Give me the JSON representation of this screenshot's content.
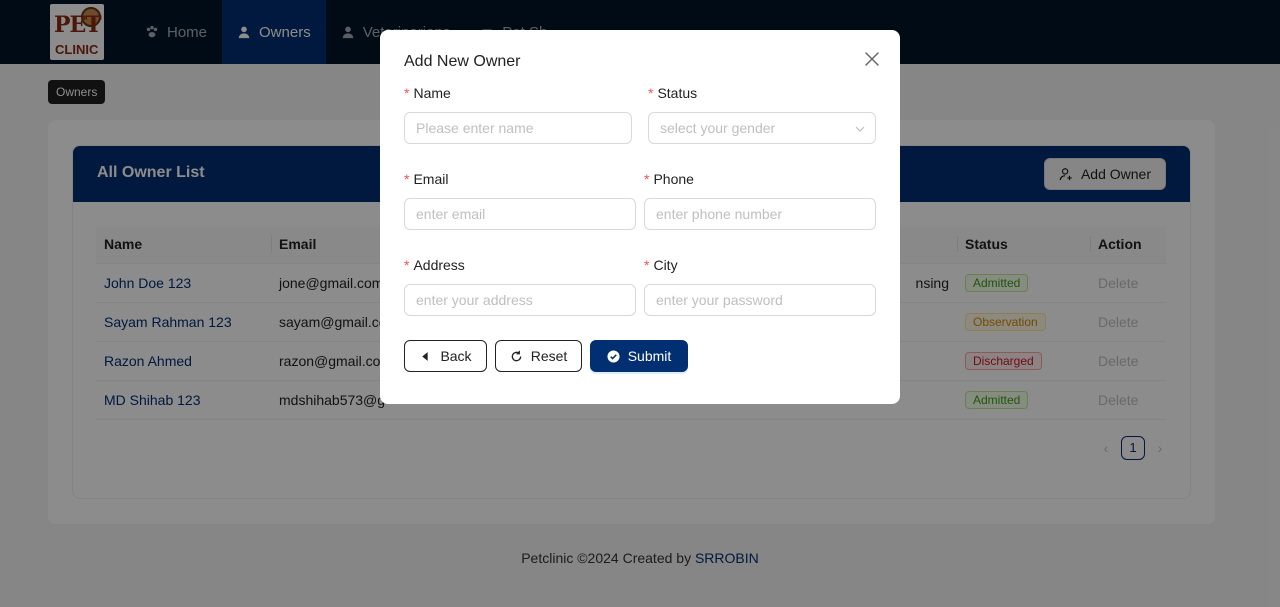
{
  "header": {
    "logo": {
      "line1": "PET",
      "line2": "CLINIC"
    },
    "nav": [
      {
        "label": "Home",
        "icon": "paw-icon",
        "active": false
      },
      {
        "label": "Owners",
        "icon": "user-icon",
        "active": true
      },
      {
        "label": "Veterinarians",
        "icon": "doctor-icon",
        "active": false
      },
      {
        "label": "Pet Sh...",
        "icon": "pet-icon",
        "active": false
      }
    ]
  },
  "breadcrumb": "Owners",
  "card": {
    "title": "All Owner List",
    "add_button": "Add Owner"
  },
  "table": {
    "columns": [
      "Name",
      "Email",
      "Status",
      "Action"
    ],
    "rows": [
      {
        "name": "John Doe 123",
        "email": "jone@gmail.com",
        "extra": "nsing",
        "status": "Admitted",
        "status_color": "green",
        "action": "Delete"
      },
      {
        "name": "Sayam Rahman 123",
        "email": "sayam@gmail.co",
        "extra": "",
        "status": "Observation",
        "status_color": "orange",
        "action": "Delete"
      },
      {
        "name": "Razon Ahmed",
        "email": "razon@gmail.co",
        "extra": "",
        "status": "Discharged",
        "status_color": "red",
        "action": "Delete"
      },
      {
        "name": "MD Shihab 123",
        "email": "mdshihab573@g",
        "extra": "",
        "status": "Admitted",
        "status_color": "green",
        "action": "Delete"
      }
    ]
  },
  "pagination": {
    "current": "1",
    "prev": "‹",
    "next": "›"
  },
  "footer": {
    "text": "Petclinic ©2024 Created by ",
    "author": "SRROBIN"
  },
  "modal": {
    "title": "Add New Owner",
    "fields": {
      "name": {
        "label": "Name",
        "placeholder": "Please enter  name"
      },
      "status": {
        "label": "Status",
        "placeholder": "select your gender"
      },
      "email": {
        "label": "Email",
        "placeholder": " enter  email"
      },
      "phone": {
        "label": "Phone",
        "placeholder": "enter phone number"
      },
      "address": {
        "label": "Address",
        "placeholder": " enter your address"
      },
      "city": {
        "label": "City",
        "placeholder": "enter your password"
      }
    },
    "buttons": {
      "back": "Back",
      "reset": "Reset",
      "submit": "Submit"
    }
  },
  "colors": {
    "primary": "#022f71",
    "header_bg": "#001529",
    "required": "#ff4d4f"
  }
}
